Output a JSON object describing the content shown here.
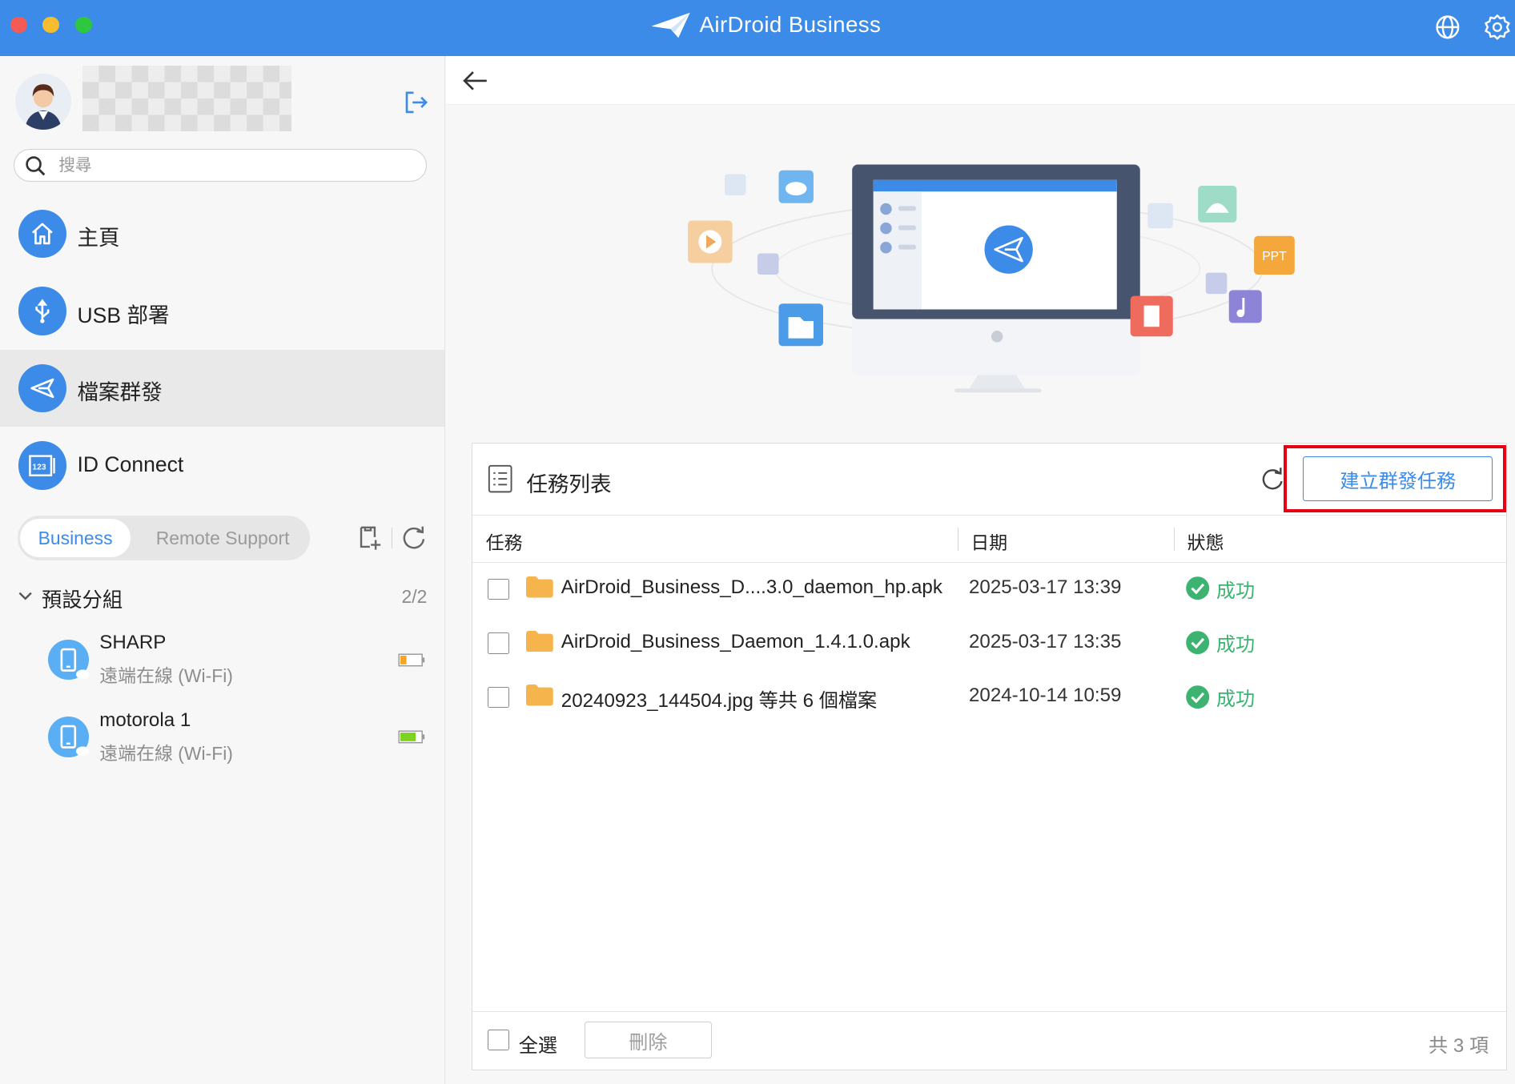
{
  "window": {
    "app_name": "AirDroid Business",
    "accent_color": "#3d8be8",
    "icons": [
      "globe-icon",
      "settings-gear-icon"
    ]
  },
  "sidebar": {
    "search_placeholder": "搜尋",
    "nav": [
      {
        "label": "主頁",
        "icon": "home-icon"
      },
      {
        "label": "USB 部署",
        "icon": "usb-icon"
      },
      {
        "label": "檔案群發",
        "icon": "send-plane-icon",
        "active": true
      },
      {
        "label": "ID Connect",
        "icon": "id-123-icon"
      }
    ],
    "tabs": {
      "business": "Business",
      "remote_support": "Remote Support"
    },
    "group": {
      "title": "預設分組",
      "count": "2/2"
    },
    "devices": [
      {
        "name": "SHARP",
        "status": "遠端在線 (Wi-Fi)",
        "battery_level": 0.3,
        "battery_color": "#f5a623"
      },
      {
        "name": "motorola 1",
        "status": "遠端在線 (Wi-Fi)",
        "battery_level": 0.75,
        "battery_color": "#7ed321"
      }
    ]
  },
  "main": {
    "panel": {
      "title": "任務列表",
      "create_button": "建立群發任務",
      "columns": {
        "task": "任務",
        "date": "日期",
        "status": "狀態"
      },
      "rows": [
        {
          "name": "AirDroid_Business_D....3.0_daemon_hp.apk",
          "date": "2025-03-17 13:39",
          "status": "成功"
        },
        {
          "name": "AirDroid_Business_Daemon_1.4.1.0.apk",
          "date": "2025-03-17 13:35",
          "status": "成功"
        },
        {
          "name": "20240923_144504.jpg 等共 6 個檔案",
          "date": "2024-10-14 10:59",
          "status": "成功"
        }
      ],
      "footer": {
        "select_all": "全選",
        "delete": "刪除",
        "total": "共 3 項"
      }
    }
  }
}
